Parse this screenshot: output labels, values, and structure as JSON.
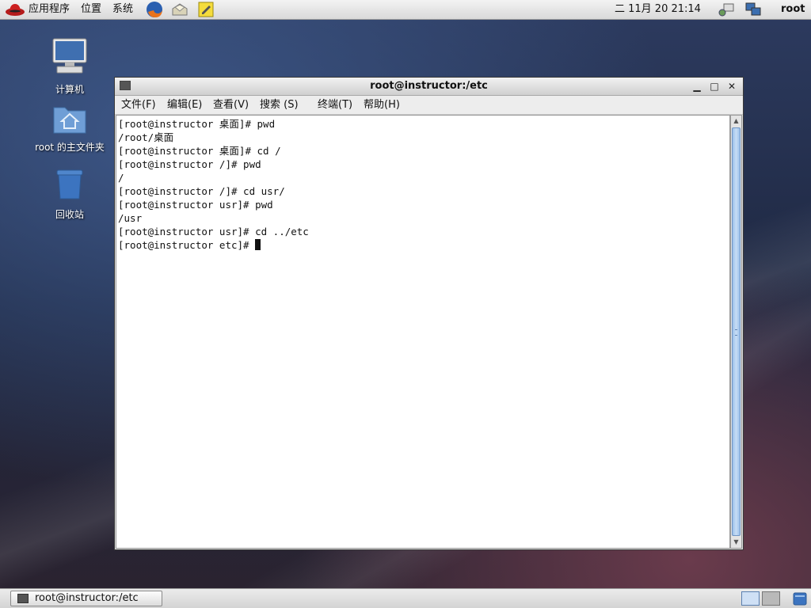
{
  "top_panel": {
    "menus": [
      "应用程序",
      "位置",
      "系统"
    ],
    "launchers": [
      "firefox-icon",
      "mail-icon",
      "notes-icon"
    ],
    "clock": "二 11月 20 21:14",
    "user": "root"
  },
  "desktop": {
    "icons": [
      {
        "label": "计算机",
        "icon": "computer-icon"
      },
      {
        "label": "root 的主文件夹",
        "icon": "home-folder-icon"
      },
      {
        "label": "回收站",
        "icon": "trash-icon"
      }
    ]
  },
  "window": {
    "title": "root@instructor:/etc",
    "menu": [
      "文件(F)",
      "编辑(E)",
      "查看(V)",
      "搜索 (S)",
      "终端(T)",
      "帮助(H)"
    ],
    "terminal_lines": [
      "[root@instructor 桌面]# pwd",
      "/root/桌面",
      "[root@instructor 桌面]# cd /",
      "[root@instructor /]# pwd",
      "/",
      "[root@instructor /]# cd usr/",
      "[root@instructor usr]# pwd",
      "/usr",
      "[root@instructor usr]# cd ../etc",
      "[root@instructor etc]# "
    ]
  },
  "taskbar": {
    "tasks": [
      {
        "label": "root@instructor:/etc"
      }
    ],
    "accent": "#6f95c4"
  }
}
